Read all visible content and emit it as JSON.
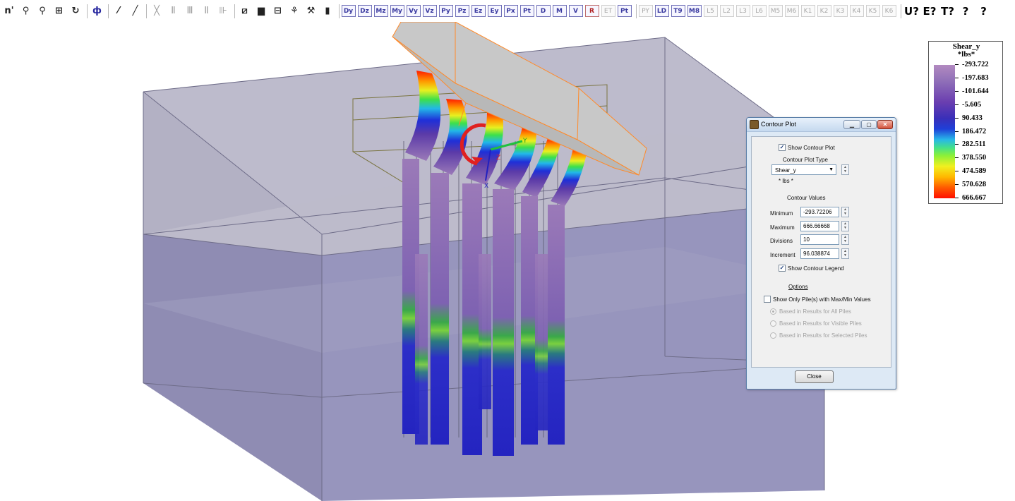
{
  "toolbar": {
    "items": [
      {
        "label": "n'",
        "name": "node-tool-button",
        "style": ""
      },
      {
        "label": "⚲",
        "name": "probe-pin-button",
        "style": ""
      },
      {
        "label": "⚲",
        "name": "probe-pin2-button",
        "style": ""
      },
      {
        "label": "⊞",
        "name": "grid-button",
        "style": ""
      },
      {
        "label": "↻",
        "name": "rotate-button",
        "style": ""
      },
      {
        "sep": true
      },
      {
        "label": "ф",
        "name": "pile-cap-button",
        "style": "blue"
      },
      {
        "sep": true
      },
      {
        "label": "⁄",
        "name": "dashed-line-button",
        "style": ""
      },
      {
        "label": "╱",
        "name": "line-button",
        "style": ""
      },
      {
        "sep": true
      },
      {
        "label": "╳",
        "name": "delete-pile-button",
        "style": "grey"
      },
      {
        "label": "Ⅱ",
        "name": "pile-group-button",
        "style": "grey"
      },
      {
        "label": "Ⅲ",
        "name": "pile-group2-button",
        "style": "grey"
      },
      {
        "label": "Ⅱ",
        "name": "pile-group3-button",
        "style": "grey"
      },
      {
        "label": "⊪",
        "name": "pile-group4-button",
        "style": "grey"
      },
      {
        "sep": true
      },
      {
        "label": "⧄",
        "name": "deformed-shape-button",
        "style": ""
      },
      {
        "label": "▆",
        "name": "color-contour-button",
        "style": ""
      },
      {
        "label": "⊟",
        "name": "report-button",
        "style": ""
      },
      {
        "label": "⚘",
        "name": "loads-button",
        "style": ""
      },
      {
        "label": "⚒",
        "name": "soil-button",
        "style": ""
      },
      {
        "label": "▮",
        "name": "scale-button",
        "style": ""
      },
      {
        "sep": true
      },
      {
        "label": "Dy",
        "name": "result-dy-button",
        "style": "res"
      },
      {
        "label": "Dz",
        "name": "result-dz-button",
        "style": "res"
      },
      {
        "label": "Mz",
        "name": "result-mz-button",
        "style": "res"
      },
      {
        "label": "My",
        "name": "result-my-button",
        "style": "res"
      },
      {
        "label": "Vy",
        "name": "result-vy-button",
        "style": "res"
      },
      {
        "label": "Vz",
        "name": "result-vz-button",
        "style": "res"
      },
      {
        "label": "Py",
        "name": "result-py-button",
        "style": "res"
      },
      {
        "label": "Pz",
        "name": "result-pz-button",
        "style": "res"
      },
      {
        "label": "Ez",
        "name": "result-ez-button",
        "style": "res"
      },
      {
        "label": "Ey",
        "name": "result-ey-button",
        "style": "res"
      },
      {
        "label": "Px",
        "name": "result-px-button",
        "style": "res"
      },
      {
        "label": "Pt",
        "name": "result-pt-button",
        "style": "res"
      },
      {
        "label": "D",
        "name": "result-d-button",
        "style": "res"
      },
      {
        "label": "M",
        "name": "result-m-button",
        "style": "res"
      },
      {
        "label": "V",
        "name": "result-v-button",
        "style": "res"
      },
      {
        "label": "R",
        "name": "result-r-button",
        "style": "res red"
      },
      {
        "label": "ET",
        "name": "result-et-button",
        "style": "res dis"
      },
      {
        "label": "Pt",
        "name": "result-pt2-button",
        "style": "res"
      },
      {
        "sep": true
      },
      {
        "label": "PY",
        "name": "result-py2-button",
        "style": "res dis"
      },
      {
        "label": "LD",
        "name": "result-ld-button",
        "style": "res"
      },
      {
        "label": "T9",
        "name": "result-t9-button",
        "style": "res"
      },
      {
        "label": "M8",
        "name": "result-m8-button",
        "style": "res"
      },
      {
        "label": "L5",
        "name": "result-l5-button",
        "style": "res dis"
      },
      {
        "label": "L2",
        "name": "result-l2-button",
        "style": "res dis"
      },
      {
        "label": "L3",
        "name": "result-l3-button",
        "style": "res dis"
      },
      {
        "label": "L6",
        "name": "result-l6-button",
        "style": "res dis"
      },
      {
        "label": "M5",
        "name": "result-m5-button",
        "style": "res dis"
      },
      {
        "label": "M6",
        "name": "result-m6-button",
        "style": "res dis"
      },
      {
        "label": "K1",
        "name": "result-k1-button",
        "style": "res dis"
      },
      {
        "label": "K2",
        "name": "result-k2-button",
        "style": "res dis"
      },
      {
        "label": "K3",
        "name": "result-k3-button",
        "style": "res dis"
      },
      {
        "label": "K4",
        "name": "result-k4-button",
        "style": "res dis"
      },
      {
        "label": "K5",
        "name": "result-k5-button",
        "style": "res dis"
      },
      {
        "label": "K6",
        "name": "result-k6-button",
        "style": "res dis"
      },
      {
        "sep": true
      },
      {
        "label": "U?",
        "name": "units-help-button",
        "style": "help"
      },
      {
        "label": "E?",
        "name": "error-help-button",
        "style": "help"
      },
      {
        "label": "T?",
        "name": "tips-help-button",
        "style": "help"
      },
      {
        "label": "?",
        "name": "bulb-help-button",
        "style": "help"
      },
      {
        "label": "?",
        "name": "about-help-button",
        "style": "help"
      }
    ]
  },
  "axes": {
    "x": "X",
    "y": "Y",
    "z": "Z"
  },
  "legend": {
    "title_line1": "Shear_y",
    "title_line2": "*lbs*",
    "ticks": [
      "-293.722",
      "-197.683",
      "-101.644",
      "-5.605",
      "90.433",
      "186.472",
      "282.511",
      "378.550",
      "474.589",
      "570.628",
      "666.667"
    ]
  },
  "dialog": {
    "title": "Contour Plot",
    "show_contour_plot": "Show Contour Plot",
    "contour_plot_type_label": "Contour Plot Type",
    "contour_plot_type_value": "Shear_y",
    "unit": "* lbs *",
    "contour_values_label": "Contour Values",
    "minimum_label": "Minimum",
    "minimum_value": "-293.72206",
    "maximum_label": "Maximum",
    "maximum_value": "666.66668",
    "divisions_label": "Divisions",
    "divisions_value": "10",
    "increment_label": "Increment",
    "increment_value": "96.038874",
    "show_contour_legend": "Show Contour Legend",
    "options_label": "Options",
    "show_only_piles": "Show Only Pile(s) with Max/Min Values",
    "radio_all": "Based in Results for All Piles",
    "radio_visible": "Based in Results for Visible Piles",
    "radio_selected": "Based in Results for Selected Piles",
    "close_label": "Close"
  }
}
